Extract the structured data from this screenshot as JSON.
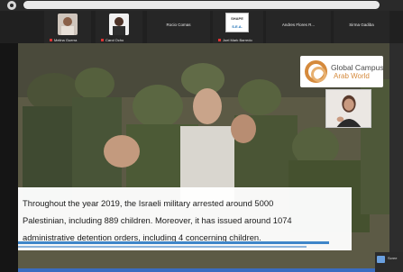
{
  "participants": [
    {
      "name": "Melina Guerra"
    },
    {
      "name": "Carol Ocho"
    },
    {
      "name": "Rocio Comas"
    },
    {
      "name": "Joel Mark Barredo"
    },
    {
      "name": "Andres Flores R..."
    },
    {
      "name": "Sirma Gadiba"
    }
  ],
  "shape_logo": {
    "line1": "SHAPE",
    "line2": "S.E.A."
  },
  "slide": {
    "logo": {
      "title": "Global Campus",
      "subtitle": "Arab World"
    },
    "caption_lines": [
      "Throughout the year 2019, the Israeli military arrested around 5000",
      "Palestinian, including 889 children. Moreover, it has issued around 1074",
      "administrative detention orders, including 4 concerning children."
    ]
  },
  "screen_share": {
    "label": "Scree"
  },
  "colors": {
    "logo_orange": "#d58a3c",
    "underline": "#3f86c9",
    "muted_mic": "#dd3333"
  }
}
